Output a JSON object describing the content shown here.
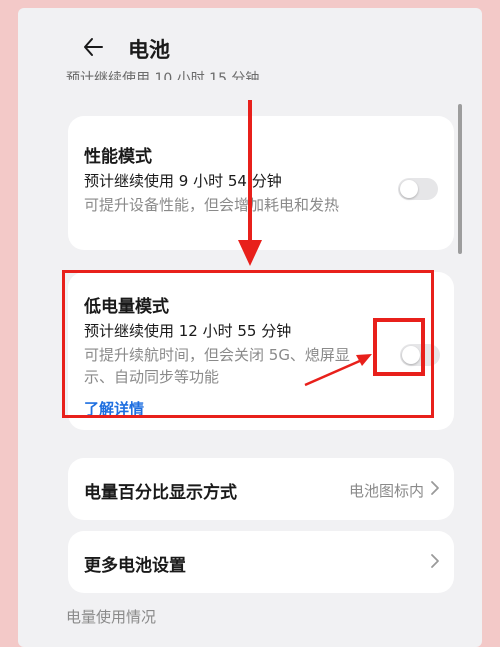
{
  "header": {
    "title": "电池"
  },
  "top_partial_text": "预计继续使用 10 小时 15 分钟",
  "performance_mode": {
    "title": "性能模式",
    "estimate": "预计继续使用 9 小时 54 分钟",
    "description": "可提升设备性能，但会增加耗电和发热"
  },
  "low_power_mode": {
    "title": "低电量模式",
    "estimate": "预计继续使用 12 小时 55 分钟",
    "description": "可提升续航时间，但会关闭 5G、熄屏显示、自动同步等功能",
    "link": "了解详情"
  },
  "battery_percent_display": {
    "label": "电量百分比显示方式",
    "value": "电池图标内"
  },
  "more_settings": {
    "label": "更多电池设置"
  },
  "usage_section": {
    "label": "电量使用情况"
  },
  "colors": {
    "background_pink": "#f3c9c8",
    "panel": "#f1f1f3",
    "card": "#ffffff",
    "link_blue": "#1f6fe0",
    "annotation_red": "#e8201b"
  },
  "icons": [
    "back-arrow-icon",
    "chevron-right-icon",
    "toggle-switch"
  ]
}
